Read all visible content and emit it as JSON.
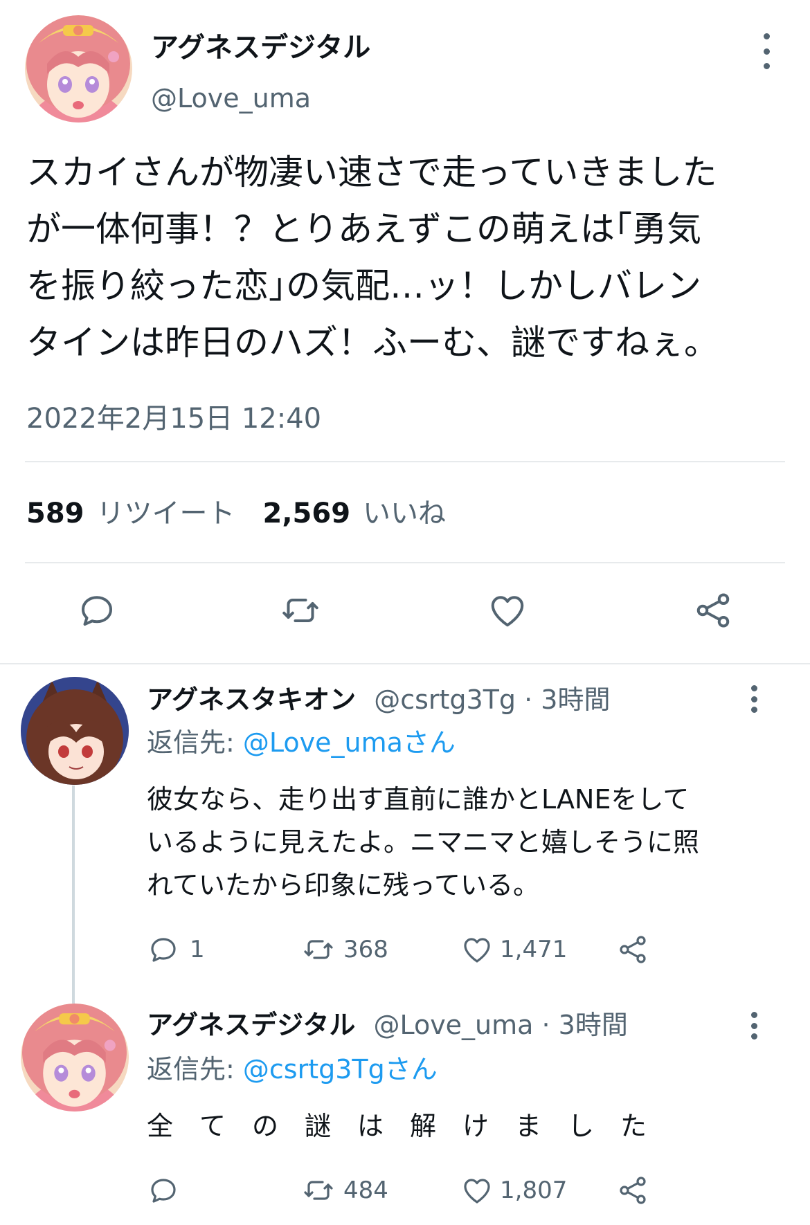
{
  "main_tweet": {
    "display_name": "アグネスデジタル",
    "handle": "@Love_uma",
    "text_lines": [
      "スカイさんが物凄い速さで走っていきました",
      "が一体何事！？とりあえずこの萌えは｢勇気",
      "を振り絞った恋｣の気配…ッ！しかしバレン",
      "タインは昨日のハズ！ふーむ、謎ですねぇ。"
    ],
    "timestamp": "2022年2月15日 12:40",
    "retweet_count": "589",
    "retweet_label": "リツイート",
    "like_count": "2,569",
    "like_label": "いいね",
    "icons": [
      "reply-icon",
      "retweet-icon",
      "like-icon",
      "share-icon"
    ]
  },
  "replies": [
    {
      "display_name": "アグネスタキオン",
      "handle_time": "@csrtg3Tg · 3時間",
      "reply_to_prefix": "返信先: ",
      "reply_to_user": "@Love_umaさん",
      "text_lines": [
        "彼女なら、走り出す直前に誰かとLANEをして",
        "いるように見えたよ。ニマニマと嬉しそうに照",
        "れていたから印象に残っている。"
      ],
      "reply_count": "1",
      "retweet_count": "368",
      "like_count": "1,471"
    },
    {
      "display_name": "アグネスデジタル",
      "handle_time": "@Love_uma · 3時間",
      "reply_to_prefix": "返信先: ",
      "reply_to_user": "@csrtg3Tgさん",
      "text_lines": [
        "全　て　の　謎　は　解　け　ま　し　た"
      ],
      "reply_count": "",
      "retweet_count": "484",
      "like_count": "1,807"
    }
  ],
  "colors": {
    "text": "#0f1419",
    "secondary": "#536471",
    "link": "#1d9bf0",
    "divider": "#e7eaec"
  }
}
